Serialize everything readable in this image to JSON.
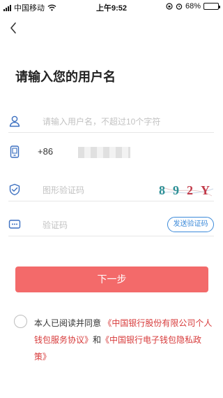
{
  "status_bar": {
    "carrier": "中国移动",
    "time": "上午9:52",
    "battery": "68%",
    "battery_level": 0.68
  },
  "page": {
    "title": "请输入您的用户名"
  },
  "form": {
    "username_placeholder": "请输入用户名，不超过10个字符",
    "country_code": "+86",
    "captcha_placeholder": "图形验证码",
    "captcha_chars": [
      "8",
      "9",
      "2",
      "Y"
    ],
    "code_placeholder": "验证码",
    "send_code_label": "发送验证码"
  },
  "actions": {
    "next_label": "下一步"
  },
  "agreement": {
    "prefix": "本人已阅读并同意",
    "link1": "《中国银行股份有限公司个人钱包服务协议》",
    "conjunction": "和",
    "link2": "《中国银行电子钱包隐私政策》"
  },
  "colors": {
    "primary_button": "#f36a6a",
    "link": "#d73a3a",
    "send_code_border": "#3c8ad9",
    "icon_stroke": "#3b6fc0"
  }
}
